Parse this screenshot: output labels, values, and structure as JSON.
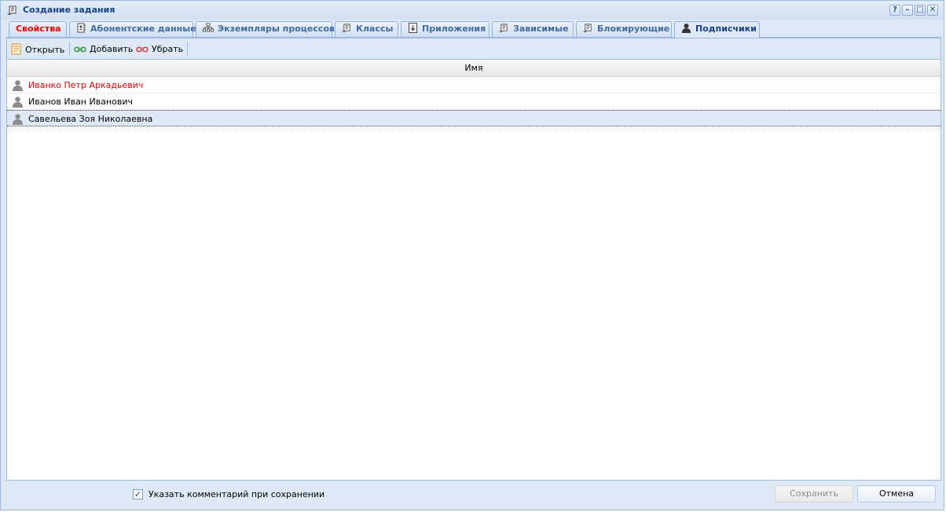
{
  "window": {
    "title": "Создание задания",
    "controls": {
      "help": "?",
      "minimize": "–",
      "maximize": "□",
      "close": "✕"
    }
  },
  "tabs": [
    {
      "label": "Свойства",
      "icon": "none",
      "active": false,
      "highlight": true
    },
    {
      "label": "Абонентские данные",
      "icon": "contact-card-icon"
    },
    {
      "label": "Экземпляры процессов",
      "icon": "process-tree-icon"
    },
    {
      "label": "Классы",
      "icon": "document-scroll-icon"
    },
    {
      "label": "Приложения",
      "icon": "attachment-download-icon"
    },
    {
      "label": "Зависимые",
      "icon": "document-scroll-icon"
    },
    {
      "label": "Блокирующие",
      "icon": "document-scroll-icon"
    },
    {
      "label": "Подписчики",
      "icon": "user-icon",
      "active": true
    }
  ],
  "toolbar": {
    "open_label": "Открыть",
    "add_label": "Добавить",
    "remove_label": "Убрать"
  },
  "grid": {
    "column_name": "Имя",
    "rows": [
      {
        "name": "Иванко Петр Аркадьевич",
        "highlight": true
      },
      {
        "name": "Иванов Иван Иванович"
      },
      {
        "name": "Савельева Зоя Николаевна",
        "selected": true
      }
    ]
  },
  "footer": {
    "comment_checkbox_label": "Указать комментарий при сохранении",
    "comment_checked": true,
    "save_label": "Сохранить",
    "cancel_label": "Отмена"
  },
  "colors": {
    "accent": "#15428b",
    "highlight_text": "#ff0000",
    "panel_bg": "#dfe8f6",
    "border": "#99bbe8"
  }
}
